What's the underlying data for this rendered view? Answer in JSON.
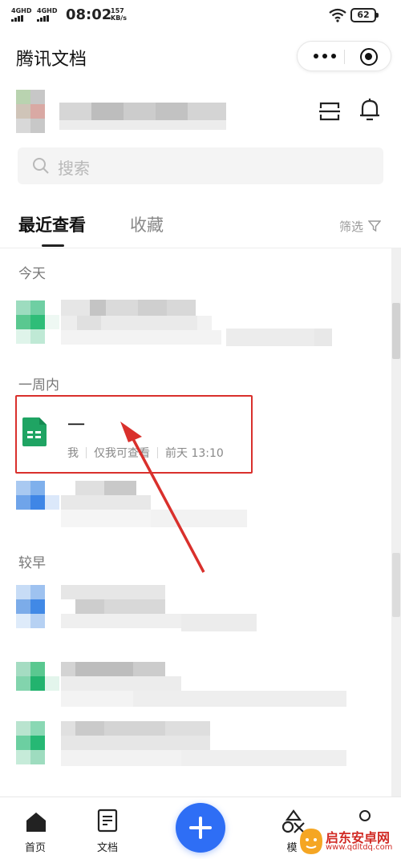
{
  "status_bar": {
    "signal1": "4GHD",
    "signal2": "4GHD",
    "time": "08:02",
    "speed_value": "157",
    "speed_unit": "KB/s",
    "battery": "62"
  },
  "app": {
    "title": "腾讯文档"
  },
  "search": {
    "placeholder": "搜索"
  },
  "tabs": {
    "recent": "最近查看",
    "favorites": "收藏"
  },
  "filter": {
    "label": "筛选"
  },
  "sections": {
    "today": "今天",
    "week": "一周内",
    "earlier": "较早"
  },
  "highlighted_file": {
    "name": "一",
    "owner": "我",
    "permission": "仅我可查看",
    "time": "前天 13:10"
  },
  "bottom_nav": {
    "home": "首页",
    "docs": "文档",
    "templates": "模"
  },
  "watermark": {
    "text": "启东安卓网",
    "url": "www.qdltdq.com"
  },
  "colors": {
    "accent": "#2e6ef5",
    "sheet_green": "#1fa463",
    "highlight_red": "#d9302c"
  }
}
